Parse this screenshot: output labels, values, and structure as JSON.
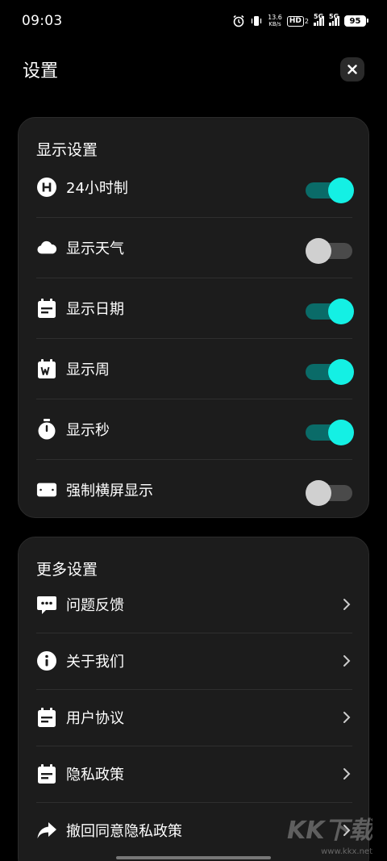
{
  "status_bar": {
    "time": "09:03",
    "net_speed_value": "13.6",
    "net_speed_unit": "KB/s",
    "hd_label": "HD",
    "hd_sub": "2",
    "sig1_label": "5G",
    "sig2_label": "5G",
    "battery": "95"
  },
  "header": {
    "title": "设置"
  },
  "display_settings": {
    "title": "显示设置",
    "items": [
      {
        "label": "24小时制",
        "icon": "h-circle-icon",
        "on": true
      },
      {
        "label": "显示天气",
        "icon": "cloud-icon",
        "on": false
      },
      {
        "label": "显示日期",
        "icon": "calendar-icon",
        "on": true
      },
      {
        "label": "显示周",
        "icon": "calendar-week-icon",
        "on": true
      },
      {
        "label": "显示秒",
        "icon": "stopwatch-icon",
        "on": true
      },
      {
        "label": "强制横屏显示",
        "icon": "landscape-icon",
        "on": false
      }
    ]
  },
  "more_settings": {
    "title": "更多设置",
    "items": [
      {
        "label": "问题反馈",
        "icon": "feedback-icon"
      },
      {
        "label": "关于我们",
        "icon": "info-icon"
      },
      {
        "label": "用户协议",
        "icon": "document-icon"
      },
      {
        "label": "隐私政策",
        "icon": "document-icon"
      },
      {
        "label": "撤回同意隐私政策",
        "icon": "share-arrow-icon"
      }
    ]
  },
  "colors": {
    "accent_knob": "#14f0e4",
    "accent_track": "#0a6b68",
    "card_bg": "#1c1c1c"
  },
  "watermark": {
    "logo_text": "KK下载",
    "url": "www.kkx.net"
  }
}
